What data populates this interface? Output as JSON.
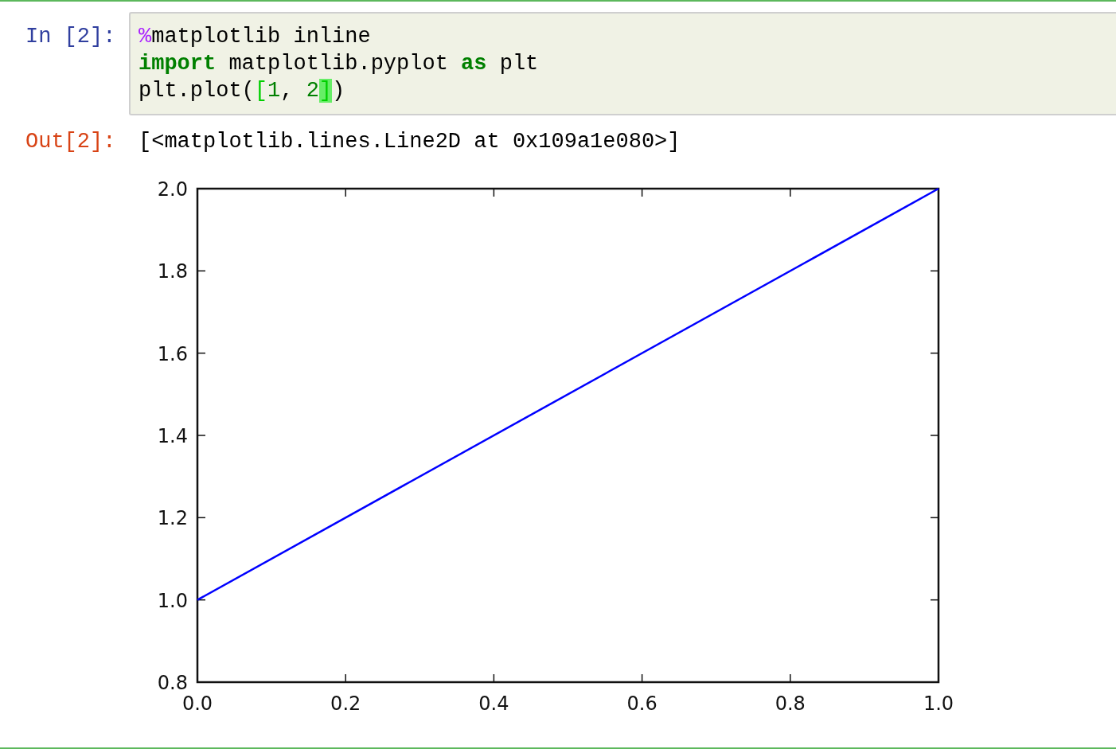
{
  "cells": [
    {
      "input": {
        "prompt": "In [2]:",
        "lines": [
          [
            {
              "kind": "magic",
              "text": "%"
            },
            {
              "kind": "plain",
              "text": "matplotlib inline"
            }
          ],
          [
            {
              "kind": "keyword",
              "text": "import"
            },
            {
              "kind": "plain",
              "text": " matplotlib.pyplot "
            },
            {
              "kind": "keyword",
              "text": "as"
            },
            {
              "kind": "plain",
              "text": " plt"
            }
          ],
          [
            {
              "kind": "plain",
              "text": "plt.plot("
            },
            {
              "kind": "bracket",
              "text": "["
            },
            {
              "kind": "number",
              "text": "1"
            },
            {
              "kind": "plain",
              "text": ", "
            },
            {
              "kind": "number",
              "text": "2"
            },
            {
              "kind": "bracket-match",
              "text": "]"
            },
            {
              "kind": "plain",
              "text": ")"
            }
          ]
        ]
      },
      "output": {
        "prompt": "Out[2]:",
        "text": "[<matplotlib.lines.Line2D at 0x109a1e080>]",
        "chart_data": {
          "type": "line",
          "x": [
            0,
            1
          ],
          "series": [
            {
              "color": "#0000ff",
              "values": [
                1,
                2
              ]
            }
          ],
          "xlim": [
            0,
            1
          ],
          "ylim": [
            0.8,
            2.0
          ],
          "xticks": [
            {
              "value": 0,
              "label": "0.0"
            },
            {
              "value": 0.2,
              "label": "0.2"
            },
            {
              "value": 0.4,
              "label": "0.4"
            },
            {
              "value": 0.6,
              "label": "0.6"
            },
            {
              "value": 0.8,
              "label": "0.8"
            },
            {
              "value": 1,
              "label": "1.0"
            }
          ],
          "yticks": [
            {
              "value": 0.8,
              "label": "0.8"
            },
            {
              "value": 1.0,
              "label": "1.0"
            },
            {
              "value": 1.2,
              "label": "1.2"
            },
            {
              "value": 1.4,
              "label": "1.4"
            },
            {
              "value": 1.6,
              "label": "1.6"
            },
            {
              "value": 1.8,
              "label": "1.8"
            },
            {
              "value": 2.0,
              "label": "2.0"
            }
          ]
        }
      }
    }
  ]
}
